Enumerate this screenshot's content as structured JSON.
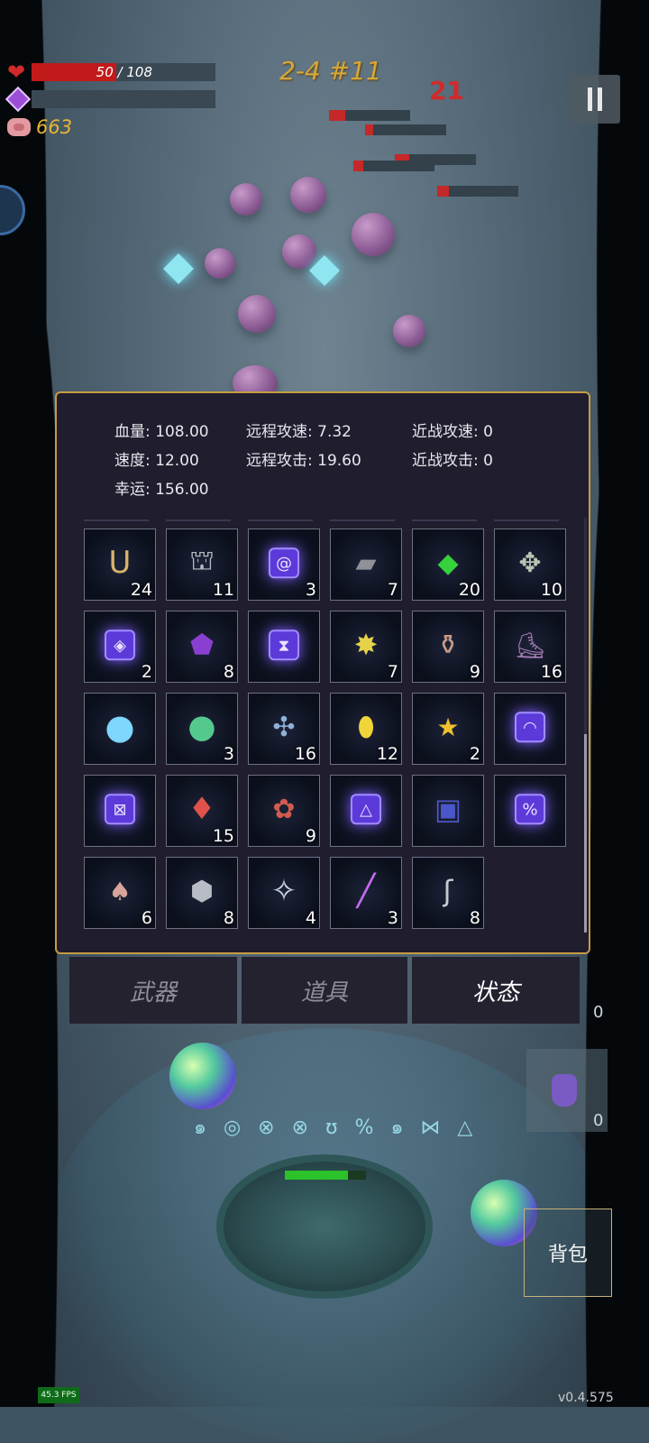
{
  "hud": {
    "hp_current": "50",
    "hp_max": "108",
    "hp_fraction": 0.46,
    "coins": "663",
    "level": "2-4 #11",
    "damage_popup": "21"
  },
  "panel": {
    "stats": [
      {
        "label": "血量:",
        "value": "108.00"
      },
      {
        "label": "远程攻速:",
        "value": "7.32"
      },
      {
        "label": "近战攻速:",
        "value": "0"
      },
      {
        "label": "速度:",
        "value": "12.00"
      },
      {
        "label": "远程攻击:",
        "value": "19.60"
      },
      {
        "label": "近战攻击:",
        "value": "0"
      },
      {
        "label": "幸运:",
        "value": "156.00"
      }
    ],
    "items": [
      {
        "icon": "horseshoe-icon",
        "count": "24"
      },
      {
        "icon": "cloak-icon",
        "count": "11"
      },
      {
        "icon": "spiral-rune-icon",
        "count": "3"
      },
      {
        "icon": "stone-tablet-icon",
        "count": "7"
      },
      {
        "icon": "green-crystal-icon",
        "count": "20"
      },
      {
        "icon": "octopus-icon",
        "count": "10"
      },
      {
        "icon": "eye-rune-icon",
        "count": "2"
      },
      {
        "icon": "purple-snail-icon",
        "count": "8"
      },
      {
        "icon": "hourglass-rune-icon",
        "count": ""
      },
      {
        "icon": "gold-star-icon",
        "count": "7"
      },
      {
        "icon": "vase-icon",
        "count": "9"
      },
      {
        "icon": "boots-icon",
        "count": "16"
      },
      {
        "icon": "blue-orb-icon",
        "count": ""
      },
      {
        "icon": "rainbow-orb-icon",
        "count": "3"
      },
      {
        "icon": "dragonfly-icon",
        "count": "16"
      },
      {
        "icon": "yellow-gem-icon",
        "count": "12"
      },
      {
        "icon": "star-trophy-icon",
        "count": "2"
      },
      {
        "icon": "arc-rune-icon",
        "count": ""
      },
      {
        "icon": "cross-rune-icon",
        "count": ""
      },
      {
        "icon": "red-crystal-icon",
        "count": "15"
      },
      {
        "icon": "red-flower-icon",
        "count": "9"
      },
      {
        "icon": "triangle-rune-icon",
        "count": ""
      },
      {
        "icon": "spellbook-icon",
        "count": ""
      },
      {
        "icon": "percent-rune-icon",
        "count": ""
      },
      {
        "icon": "mushroom-icon",
        "count": "6"
      },
      {
        "icon": "silver-ore-icon",
        "count": "8"
      },
      {
        "icon": "compass-icon",
        "count": "4"
      },
      {
        "icon": "purple-wand-icon",
        "count": "3"
      },
      {
        "icon": "hook-icon",
        "count": "8"
      }
    ]
  },
  "tabs": [
    {
      "label": "武器",
      "active": false
    },
    {
      "label": "道具",
      "active": false
    },
    {
      "label": "状态",
      "active": true
    }
  ],
  "bottom": {
    "bag_label": "背包",
    "slot_count_1": "0",
    "slot_count_2": "0",
    "fps": "45.3 FPS",
    "version": "v0.4.575",
    "rune_circle": "๑ ◎ ⊗ ⊗ ʊ % ๑ ⋈ △"
  }
}
